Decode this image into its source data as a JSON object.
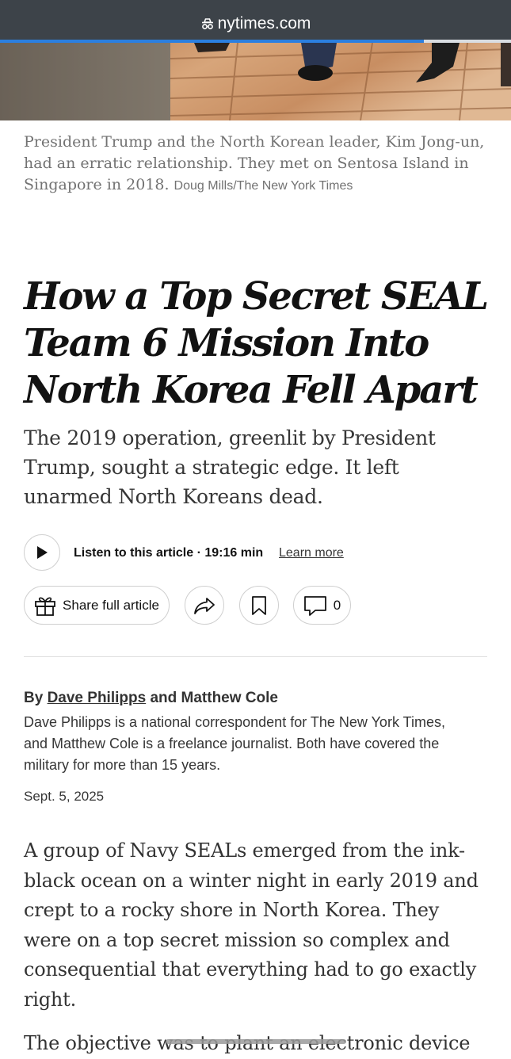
{
  "browser": {
    "url": "nytimes.com",
    "page_progress": 0.83,
    "colors": {
      "bar": "#3d4349",
      "progress": "#2b7fe0"
    }
  },
  "hero": {
    "caption": "President Trump and the North Korean leader, Kim Jong-un, had an erratic relationship. They met on Sentosa Island in Singapore in 2018.",
    "credit": "Doug Mills/The New York Times"
  },
  "article": {
    "headline": "How a Top Secret SEAL Team 6 Mission Into North Korea Fell Apart",
    "summary": "The 2019 operation, greenlit by President Trump, sought a strategic edge. It left unarmed North Koreans dead.",
    "listen": {
      "label": "Listen to this article · 19:16 min",
      "learn_more": "Learn more"
    },
    "actions": {
      "share_full": "Share full article",
      "comment_count": "0"
    },
    "byline": {
      "prefix": "By",
      "author1": "Dave Philipps",
      "conjunction": "and",
      "author2": "Matthew Cole",
      "bio": "Dave Philipps is a national correspondent for The New York Times, and Matthew Cole is a freelance journalist. Both have covered the military for more than 15 years."
    },
    "date": "Sept. 5, 2025",
    "paragraphs": [
      "A group of Navy SEALs emerged from the ink-black ocean on a winter night in early 2019 and crept to a rocky shore in North Korea. They were on a top secret mission so complex and consequential that everything had to go exactly right.",
      "The objective was to plant an electronic device"
    ]
  }
}
